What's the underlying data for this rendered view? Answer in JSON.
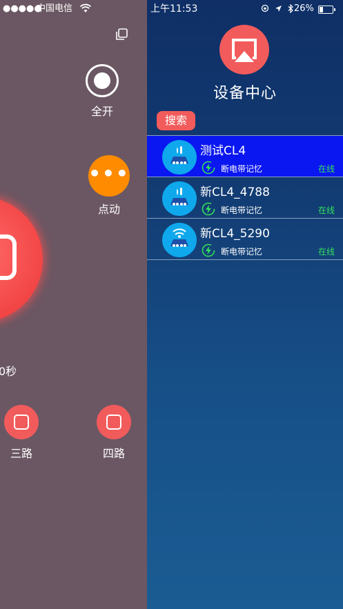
{
  "status_bar_left": {
    "dots": "●●●●●",
    "carrier": "中国电信"
  },
  "status_bar_right": {
    "time": "上午11:53",
    "battery": "26%",
    "battery_level": 0.26
  },
  "left_panel": {
    "all_on_label": "全开",
    "jog_label": "点动",
    "seconds_label": "0秒",
    "channels": [
      {
        "label": "三路"
      },
      {
        "label": "四路"
      }
    ]
  },
  "device_center": {
    "title": "设备中心",
    "search_label": "搜索",
    "devices": [
      {
        "name": "测试CL4",
        "memory": "断电带记忆",
        "status": "在线",
        "selected": true
      },
      {
        "name": "新CL4_4788",
        "memory": "断电带记忆",
        "status": "在线",
        "selected": false
      },
      {
        "name": "新CL4_5290",
        "memory": "断电带记忆",
        "status": "在线",
        "selected": false
      }
    ]
  },
  "colors": {
    "left_bg": "#6b5763",
    "accent_red": "#f25b5b",
    "jog_orange": "#ff8c00",
    "selected_row": "#0a17f0",
    "online_green": "#33e05a",
    "avatar_blue": "#0fa8ec"
  }
}
